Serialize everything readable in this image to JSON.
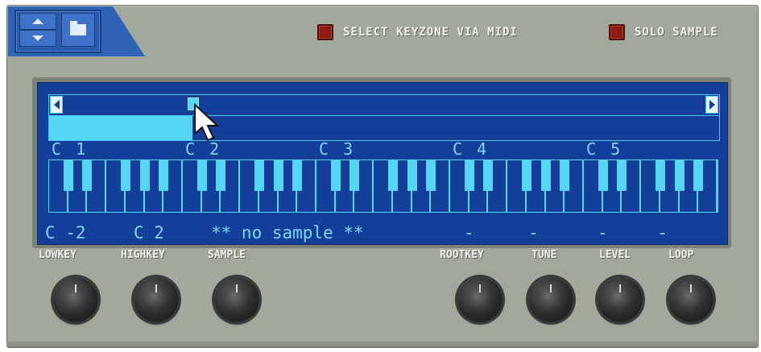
{
  "header": {
    "nav": {
      "up_icon": "arrow-up-icon",
      "down_icon": "arrow-down-icon",
      "folder_icon": "folder-icon"
    },
    "toggles": [
      {
        "label": "SELECT KEYZONE VIA MIDI",
        "led_color": "#8a1a12"
      },
      {
        "label": "SOLO SAMPLE",
        "led_color": "#8a1a12"
      }
    ]
  },
  "display": {
    "octaves": [
      "C 1",
      "C 2",
      "C 3",
      "C 4",
      "C 5"
    ],
    "keyzone": {
      "low_key": "C -2",
      "high_key": "C 2",
      "sample": "** no sample **"
    },
    "params": {
      "rootkey": "-",
      "tune": "-",
      "level": "-",
      "loop": "-"
    },
    "colors": {
      "screen": "#133e99",
      "highlight": "#54d6f4"
    }
  },
  "knobs": [
    {
      "label": "LOWKEY"
    },
    {
      "label": "HIGHKEY"
    },
    {
      "label": "SAMPLE"
    },
    {
      "label": "ROOTKEY"
    },
    {
      "label": "TUNE"
    },
    {
      "label": "LEVEL"
    },
    {
      "label": "LOOP"
    }
  ],
  "cursor_icon": "mouse-pointer-icon"
}
